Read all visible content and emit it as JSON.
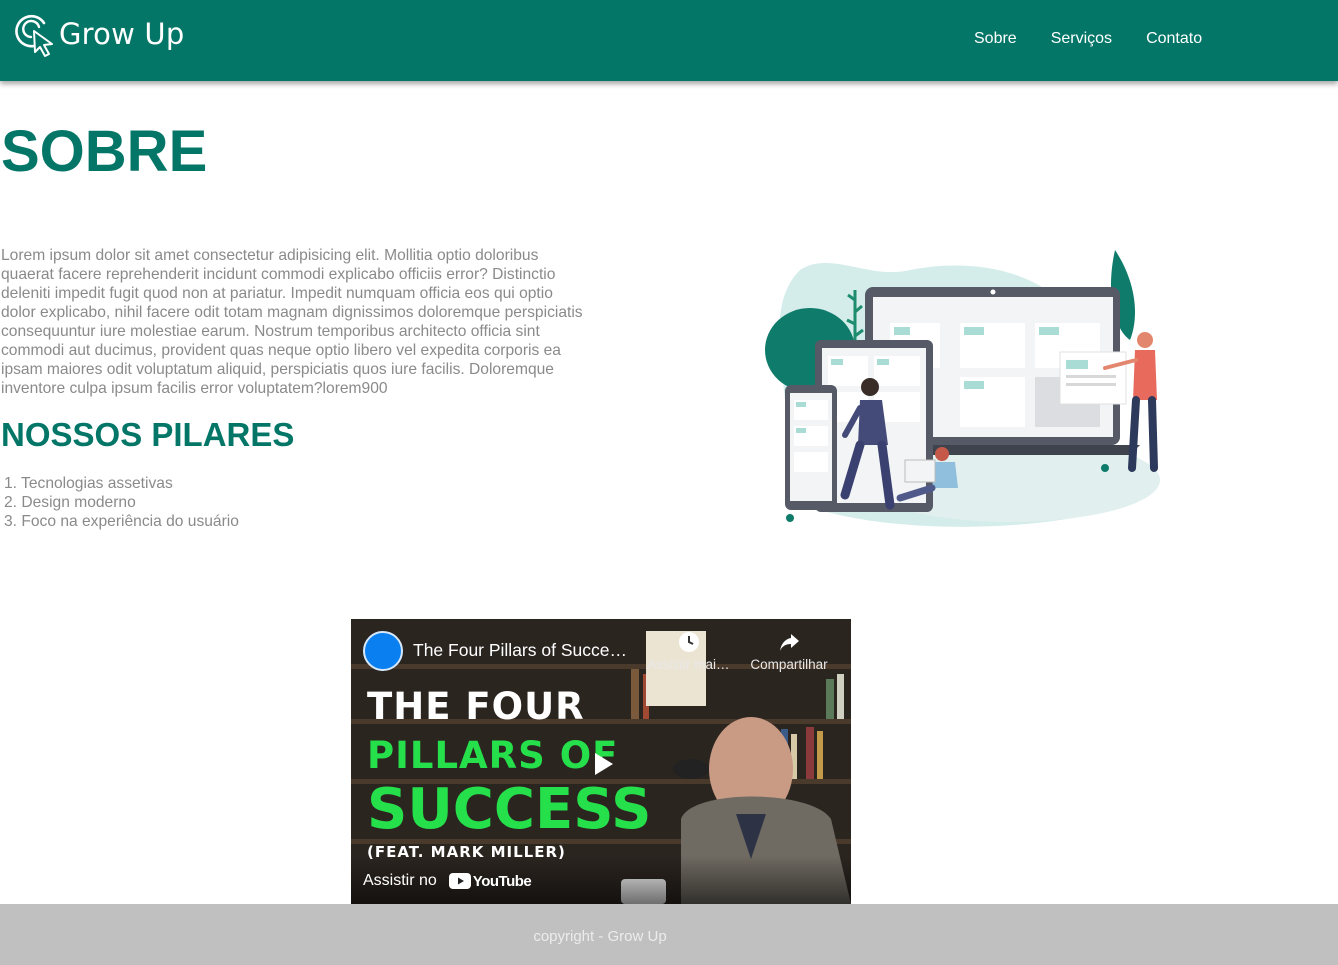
{
  "header": {
    "brand": "Grow Up",
    "nav": [
      {
        "label": "Sobre"
      },
      {
        "label": "Serviços"
      },
      {
        "label": "Contato"
      }
    ],
    "color": "#047668"
  },
  "main": {
    "title": "SOBRE",
    "paragraph": "Lorem ipsum dolor sit amet consectetur adipisicing elit. Mollitia optio doloribus quaerat facere reprehenderit incidunt commodi explicabo officiis error? Distinctio deleniti impedit fugit quod non at pariatur. Impedit numquam officia eos qui optio dolor explicabo, nihil facere odit totam magnam dignissimos doloremque perspiciatis consequuntur iure molestiae earum. Nostrum temporibus architecto officia sint commodi aut ducimus, provident quas neque optio libero vel expedita corporis ea ipsam maiores odit voluptatum aliquid, perspiciatis quos iure facilis. Doloremque inventore culpa ipsum facilis error voluptatem?lorem900",
    "subtitle": "NOSSOS PILARES",
    "pillars": [
      "1. Tecnologias assetivas",
      "2. Design moderno",
      "3. Foco na experiência do usuário"
    ],
    "illustration_icon": "devices-people-illustration"
  },
  "video": {
    "title": "The Four Pillars of Success (feat. Mark Miller)",
    "watch_later": "Assistir mais tarde",
    "share": "Compartilhar",
    "thumb_line1": "THE FOUR",
    "thumb_line2": "PILLARS OF",
    "thumb_line3": "SUCCESS",
    "thumb_line4": "(FEAT. MARK MILLER)",
    "watch_on": "Assistir no",
    "youtube": "YouTube"
  },
  "footer": {
    "text": "copyright - Grow Up"
  }
}
